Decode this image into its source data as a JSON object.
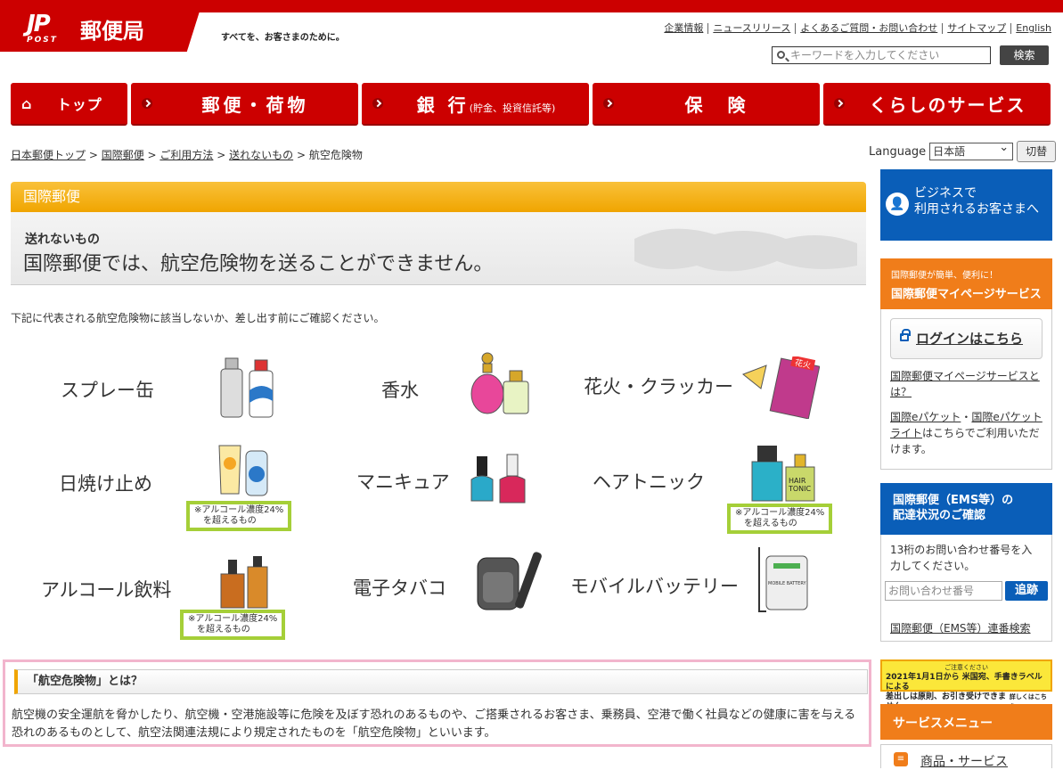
{
  "header": {
    "logo_mark": "JP",
    "logo_post": "POST",
    "logo_name": "郵便局",
    "tagline": "すべてを、お客さまのために。",
    "util_links": [
      "企業情報",
      "ニュースリリース",
      "よくあるご質問・お問い合わせ",
      "サイトマップ",
      "English"
    ],
    "search_placeholder": "キーワードを入力してください",
    "search_button": "検索"
  },
  "gnav": {
    "top": "トップ",
    "mail": "郵便・荷物",
    "bank": "銀 行",
    "bank_sub": "(貯金、投資信託等)",
    "insurance": "保　険",
    "life": "くらしのサービス"
  },
  "breadcrumb": {
    "items": [
      "日本郵便トップ",
      "国際郵便",
      "ご利用方法",
      "送れないもの"
    ],
    "current": "航空危険物"
  },
  "language": {
    "label": "Language",
    "selected": "日本語",
    "button": "切替"
  },
  "main": {
    "section_title": "国際郵便",
    "lead_sub": "送れないもの",
    "lead_main": "国際郵便では、航空危険物を送ることができません。",
    "intro": "下記に代表される航空危険物に該当しないか、差し出す前にご確認ください。",
    "items": [
      "スプレー缶",
      "香水",
      "花火・クラッカー",
      "日焼け止め",
      "マニキュア",
      "ヘアトニック",
      "アルコール飲料",
      "電子タバコ",
      "モバイルバッテリー"
    ],
    "note": "※アルコール濃度24%\n　を超えるもの",
    "firework_tag": "花火",
    "hair_tonic_tag": "HAIR\nTONIC",
    "battery_tag": "MOBILE BATTERY",
    "definition_title": "「航空危険物」とは？",
    "definition_text": "航空機の安全運航を脅かしたり、航空機・空港施設等に危険を及ぼす恐れのあるものや、ご搭乗されるお客さま、乗務員、空港で働く社員などの健康に害を与える恐れのあるものとして、航空法関連法規により規定されたものを「航空危険物」といいます。"
  },
  "sidebar": {
    "business": "ビジネスで\n利用されるお客さまへ",
    "mypage_sub": "国際郵便が簡単、便利に！",
    "mypage_title": "国際郵便マイページサービス",
    "login": "ログインはこちら",
    "mypage_link": "国際郵便マイページサービスとは？",
    "epacket_link1": "国際eパケット",
    "epacket_sep": "・",
    "epacket_link2": "国際eパケットライト",
    "epacket_text": "はこちらでご利用いただけます。",
    "ems_title": "国際郵便（EMS等）の\n配達状況のご確認",
    "ems_desc": "13桁のお問い合わせ番号を入力してください。",
    "ems_placeholder": "お問い合わせ番号",
    "ems_button": "追跡",
    "ems_link": "国際郵便（EMS等）連番検索",
    "banner_line1": "ご注意ください",
    "banner_line2": "2021年1月1日から 米国宛、手書きラベル による",
    "banner_line3": "差出しは原則、お引き受けできません。",
    "banner_more": "詳しくはこちら",
    "service_menu": "サービスメニュー",
    "service_item": "商品・サービス"
  },
  "colors": {
    "brand_red": "#cc0000",
    "orange": "#f0a500",
    "blue": "#0a5eb8",
    "note_green": "#a5cf38"
  }
}
